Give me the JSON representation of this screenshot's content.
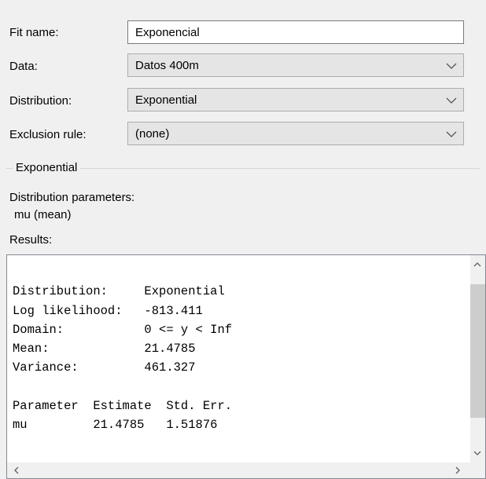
{
  "form": {
    "fit_name_label": "Fit name:",
    "fit_name_value": "Exponencial",
    "data_label": "Data:",
    "data_value": "Datos 400m",
    "distribution_label": "Distribution:",
    "distribution_value": "Exponential",
    "exclusion_label": "Exclusion rule:",
    "exclusion_value": "(none)"
  },
  "group": {
    "title": "Exponential",
    "params_label": "Distribution parameters:",
    "param_mu": "mu (mean)",
    "results_label": "Results:"
  },
  "results": {
    "lines": [
      "Distribution:     Exponential",
      "Log likelihood:   -813.411",
      "Domain:           0 <= y < Inf",
      "Mean:             21.4785",
      "Variance:         461.327",
      "",
      "Parameter  Estimate  Std. Err.",
      "mu         21.4785   1.51876"
    ]
  },
  "icons": {
    "dropdown": "chevron-down-icon",
    "scroll_up": "scroll-up-icon",
    "scroll_down": "scroll-down-icon",
    "scroll_left": "scroll-left-icon",
    "scroll_right": "scroll-right-icon"
  }
}
